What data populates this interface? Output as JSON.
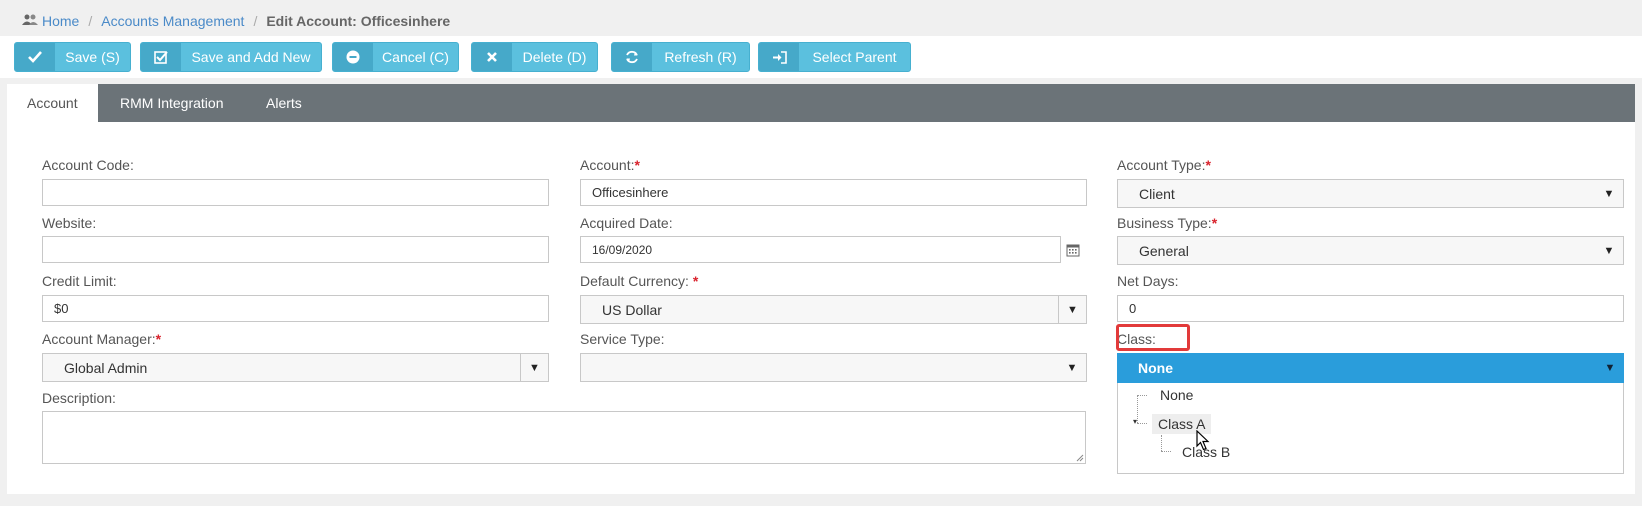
{
  "breadcrumb": {
    "home": "Home",
    "accounts": "Accounts Management",
    "current": "Edit Account: Officesinhere"
  },
  "toolbar": {
    "save": "Save (S)",
    "save_add_new": "Save and Add New",
    "cancel": "Cancel (C)",
    "delete": "Delete (D)",
    "refresh": "Refresh (R)",
    "select_parent": "Select Parent"
  },
  "tabs": [
    "Account",
    "RMM Integration",
    "Alerts"
  ],
  "form": {
    "account_code": {
      "label": "Account Code:",
      "value": ""
    },
    "account": {
      "label": "Account:",
      "value": "Officesinhere"
    },
    "account_type": {
      "label": "Account Type:",
      "value": "Client"
    },
    "website": {
      "label": "Website:",
      "value": ""
    },
    "acquired_date": {
      "label": "Acquired Date:",
      "value": "16/09/2020"
    },
    "business_type": {
      "label": "Business Type:",
      "value": "General"
    },
    "credit_limit": {
      "label": "Credit Limit:",
      "value": "$0"
    },
    "default_currency": {
      "label": "Default Currency: ",
      "value": "US Dollar"
    },
    "net_days": {
      "label": "Net Days:",
      "value": "0"
    },
    "account_manager": {
      "label": "Account Manager:",
      "value": "Global Admin"
    },
    "service_type": {
      "label": "Service Type:",
      "value": ""
    },
    "class": {
      "label": "Class:",
      "value": "None"
    },
    "description": {
      "label": "Description:",
      "value": ""
    },
    "required_mark": "*"
  },
  "class_options": [
    "None",
    "Class A",
    "Class B"
  ],
  "colors": {
    "button": "#5bc0de",
    "tabbar": "#6b7378",
    "selected_dropdown": "#2a9ddb",
    "highlight": "#e23a3a",
    "link": "#4a8ac8"
  }
}
